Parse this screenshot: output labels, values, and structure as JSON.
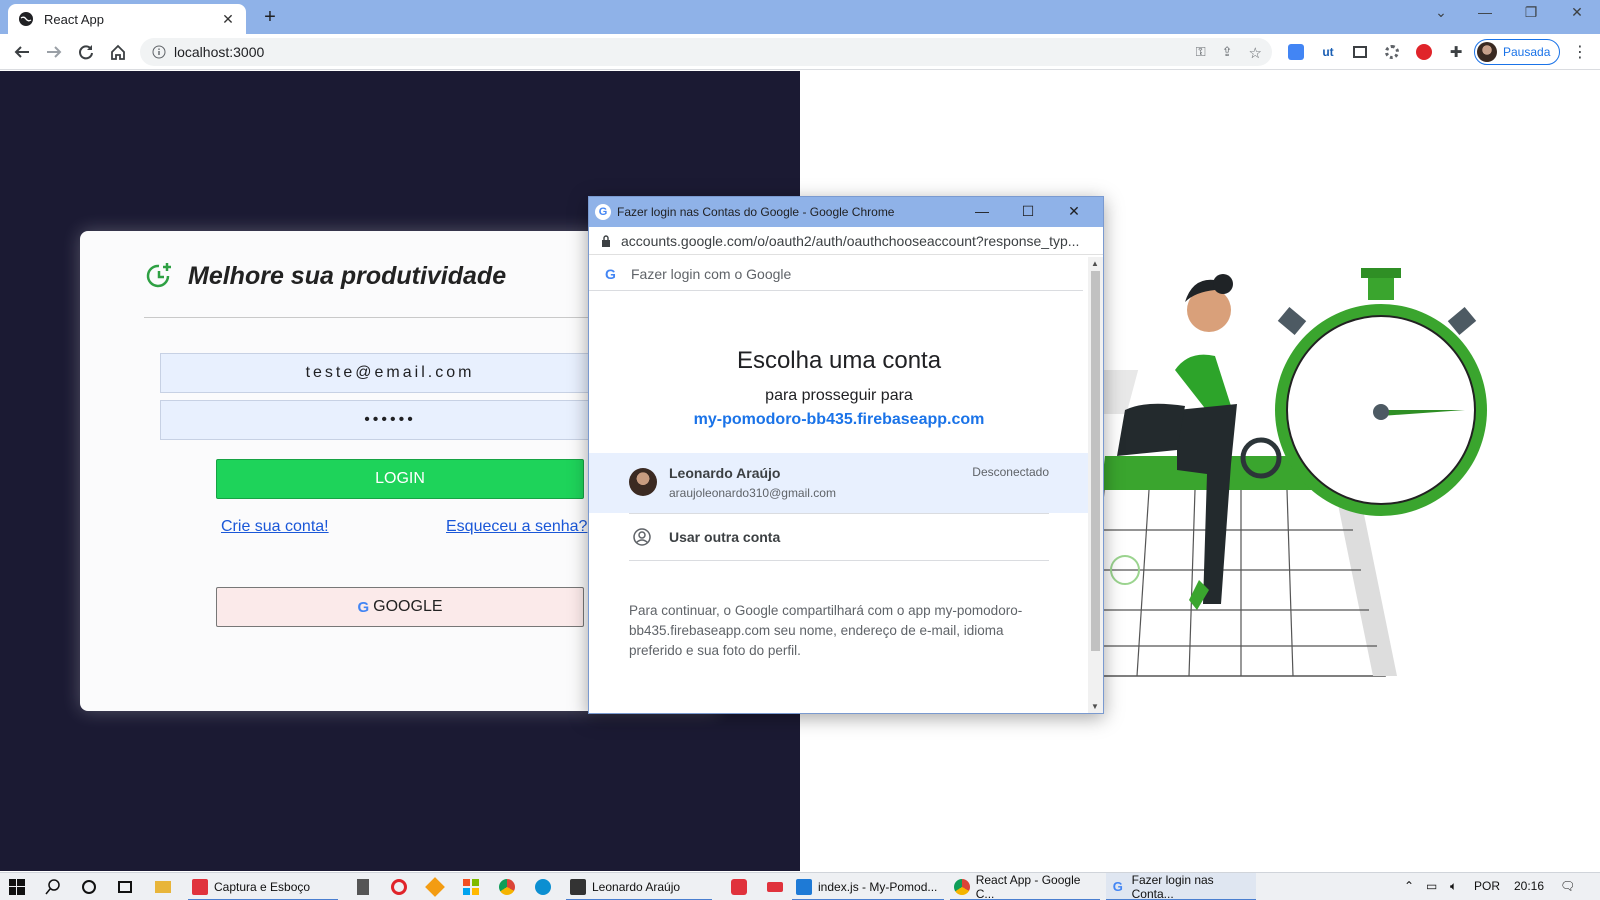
{
  "browser": {
    "tab_title": "React App",
    "tab_close": "✕",
    "new_tab": "+",
    "url": "localhost:3000",
    "profile_label": "Pausada"
  },
  "login": {
    "title": "Melhore sua produtividade",
    "email_value": "teste@email.com",
    "password_value": "••••••",
    "login_button": "LOGIN",
    "signup_link": "Crie sua conta!",
    "forgot_link": "Esqueceu a senha?",
    "google_button": "GOOGLE",
    "accent_color": "#1ed35a"
  },
  "popup": {
    "window_title": "Fazer login nas Contas do Google - Google Chrome",
    "url": "accounts.google.com/o/oauth2/auth/oauthchooseaccount?response_typ...",
    "header": "Fazer login com o Google",
    "heading": "Escolha uma conta",
    "subheading": "para prosseguir para",
    "site": "my-pomodoro-bb435.firebaseapp.com",
    "account": {
      "name": "Leonardo Araújo",
      "email": "araujoleonardo310@gmail.com",
      "status": "Desconectado"
    },
    "other_account": "Usar outra conta",
    "consent": "Para continuar, o Google compartilhará com o app my-pomodoro-bb435.firebaseapp.com seu nome, endereço de e-mail, idioma preferido e sua foto do perfil."
  },
  "taskbar": {
    "apps": [
      {
        "label": "Captura e Esboço"
      },
      {
        "label": "Leonardo Araújo"
      },
      {
        "label": "index.js - My-Pomod..."
      },
      {
        "label": "React App - Google C..."
      },
      {
        "label": "Fazer login nas Conta..."
      }
    ],
    "language": "POR",
    "time": "20:16"
  }
}
